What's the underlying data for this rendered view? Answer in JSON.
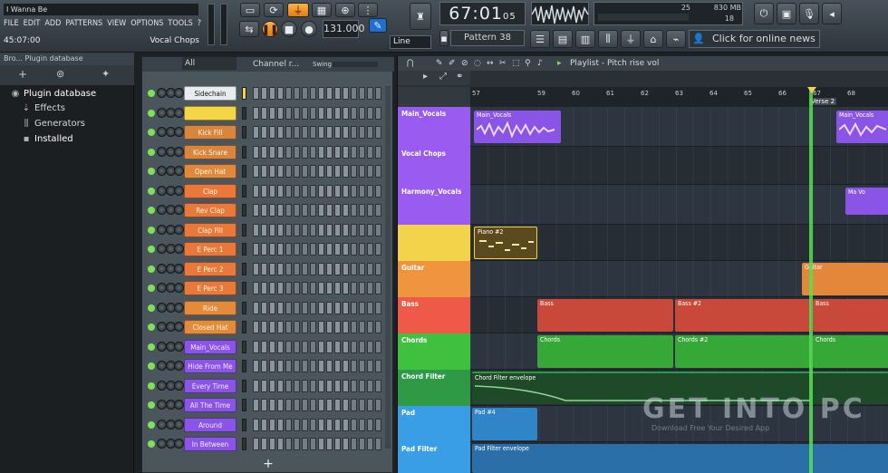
{
  "app": {
    "song_title": "I Wanna Be",
    "menu": [
      "FILE",
      "EDIT",
      "ADD",
      "PATTERNS",
      "VIEW",
      "OPTIONS",
      "TOOLS",
      "?"
    ],
    "time_readout": "45:07:00",
    "hint": "Vocal Chops"
  },
  "transport": {
    "tempo": "131.000",
    "snap_mode": "Line",
    "song_time": "67:01",
    "song_time_frac": "05",
    "pattern": "Pattern 38",
    "cpu_value": "25",
    "memory": "830 MB",
    "voices": "18",
    "online_news": "Click for online news"
  },
  "browser": {
    "header": "Bro... Plugin database",
    "items": [
      {
        "label": "Plugin database",
        "icon": "database-icon"
      },
      {
        "label": "Effects",
        "icon": "effects-icon"
      },
      {
        "label": "Generators",
        "icon": "generators-icon"
      },
      {
        "label": "Installed",
        "icon": "installed-icon"
      }
    ]
  },
  "channel_rack": {
    "filter": "All",
    "title": "Channel r...",
    "swing_label": "Swing",
    "add_symbol": "+",
    "channels": [
      {
        "name": "Sidechain",
        "color": "#e6ecef",
        "text": "#111111"
      },
      {
        "name": "",
        "color": "#f4d545",
        "text": "#3a2e00"
      },
      {
        "name": "Kick Fill",
        "color": "#d8853f",
        "text": "#fff4e0"
      },
      {
        "name": "Kick Snare",
        "color": "#d8853f",
        "text": "#fff4e0"
      },
      {
        "name": "Open Hat",
        "color": "#e1893b",
        "text": "#fff4e0"
      },
      {
        "name": "Clap",
        "color": "#e8793a",
        "text": "#fff4e0"
      },
      {
        "name": "Rev Clap",
        "color": "#e8793a",
        "text": "#fff4e0"
      },
      {
        "name": "Clap Fill",
        "color": "#e8793a",
        "text": "#fff4e0"
      },
      {
        "name": "E Perc 1",
        "color": "#e8793a",
        "text": "#fff4e0"
      },
      {
        "name": "E Perc 2",
        "color": "#e8793a",
        "text": "#fff4e0"
      },
      {
        "name": "E Perc 3",
        "color": "#e8793a",
        "text": "#fff4e0"
      },
      {
        "name": "Ride",
        "color": "#e48a3b",
        "text": "#fff4e0"
      },
      {
        "name": "Closed Hat",
        "color": "#e48a3b",
        "text": "#fff4e0"
      },
      {
        "name": "Main_Vocals",
        "color": "#8a55e6",
        "text": "#f0e8ff"
      },
      {
        "name": "Hide From Me",
        "color": "#8a55e6",
        "text": "#f0e8ff"
      },
      {
        "name": "Every Time",
        "color": "#8a55e6",
        "text": "#f0e8ff"
      },
      {
        "name": "All The Time",
        "color": "#8a55e6",
        "text": "#f0e8ff"
      },
      {
        "name": "Around",
        "color": "#8a55e6",
        "text": "#f0e8ff"
      },
      {
        "name": "In Between",
        "color": "#8a55e6",
        "text": "#f0e8ff"
      }
    ]
  },
  "playlist": {
    "title": "Playlist - Pitch rise vol",
    "ruler": [
      "57",
      "59",
      "60",
      "61",
      "62",
      "63",
      "64",
      "65",
      "66",
      "67",
      "68"
    ],
    "marker": "Verse 2",
    "tracks": [
      {
        "label": "Main_Vocals",
        "color": "#9a5cf0"
      },
      {
        "label": "Vocal Chops",
        "color": "#9a5cf0"
      },
      {
        "label": "Harmony_Vocals",
        "color": "#9a5cf0"
      },
      {
        "label": "",
        "color": "#f3d34a"
      },
      {
        "label": "Guitar",
        "color": "#f09440"
      },
      {
        "label": "Bass",
        "color": "#ef5a48"
      },
      {
        "label": "Chords",
        "color": "#3fc13f"
      },
      {
        "label": "Chord Filter",
        "color": "#2e9a46"
      },
      {
        "label": "Pad",
        "color": "#3a9ee6"
      },
      {
        "label": "Pad Filter",
        "color": "#3a9ee6"
      }
    ],
    "clips": {
      "main_vocals": "Main_Vocals",
      "main_vocals_right": "Main_Vocals",
      "no_vocals": "Ma Vo",
      "piano": "Piano #2",
      "guitar": "Guitar",
      "bass1": "Bass",
      "bass2": "Bass #2",
      "bass3": "Bass",
      "chords1": "Chords",
      "chords2": "Chords #2",
      "chords3": "Chords",
      "chord_filter": "Chord Filter envelope",
      "pad": "Pad #4",
      "pad_filter": "Pad Filter envelope"
    },
    "watermark": "GET INTO PC",
    "watermark_sub": "Download Free Your Desired App"
  }
}
